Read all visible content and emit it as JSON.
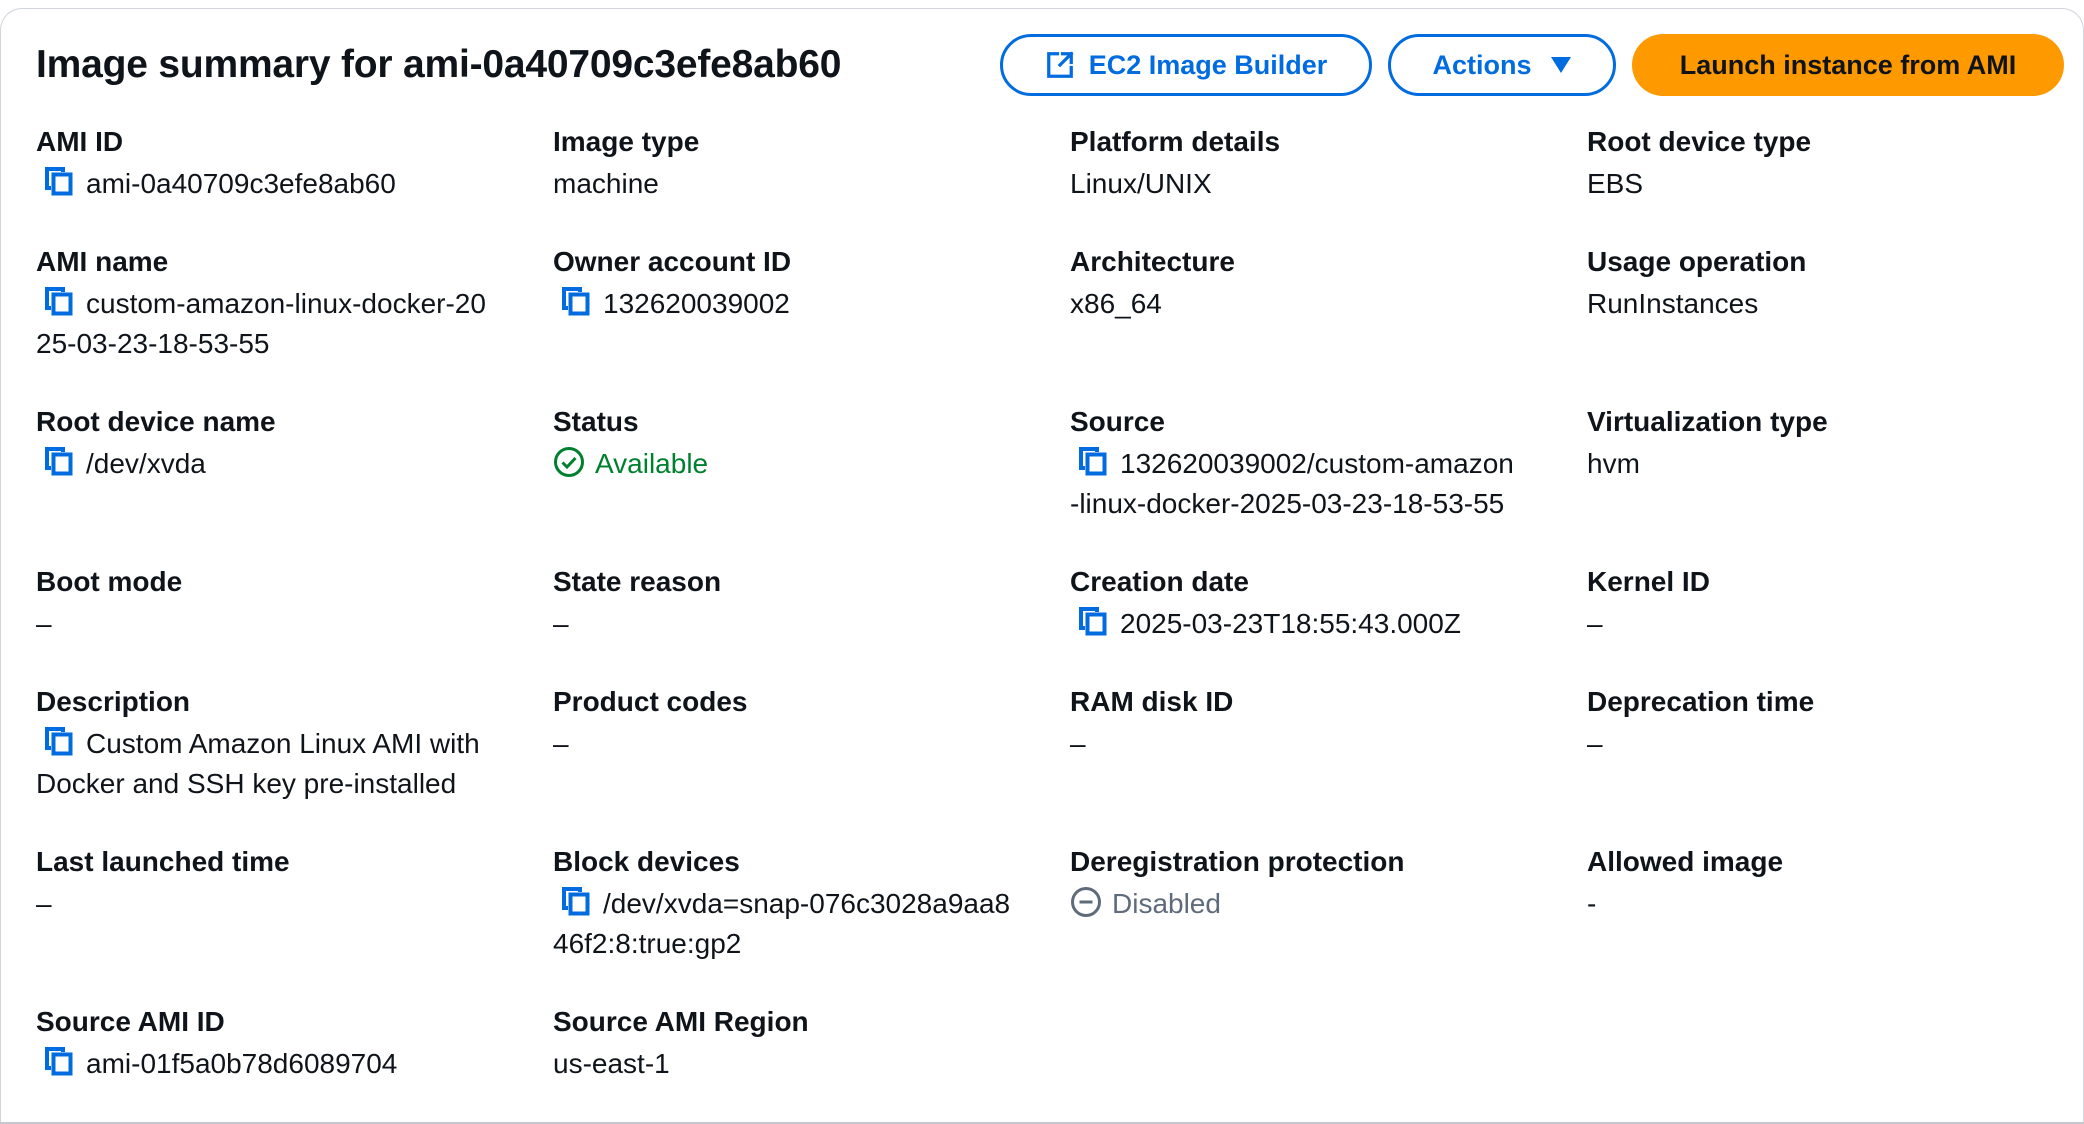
{
  "header": {
    "title": "Image summary for ami-0a40709c3efe8ab60",
    "ec2_builder_label": "EC2 Image Builder",
    "actions_label": "Actions",
    "launch_label": "Launch instance from AMI"
  },
  "fields": {
    "ami_id": {
      "label": "AMI ID",
      "value": "ami-0a40709c3efe8ab60"
    },
    "image_type": {
      "label": "Image type",
      "value": "machine"
    },
    "platform_details": {
      "label": "Platform details",
      "value": "Linux/UNIX"
    },
    "root_device_type": {
      "label": "Root device type",
      "value": "EBS"
    },
    "ami_name": {
      "label": "AMI name",
      "value_line1": "custom-amazon-linux-docker-20",
      "value_line2": "25-03-23-18-53-55"
    },
    "owner_account_id": {
      "label": "Owner account ID",
      "value": "132620039002"
    },
    "architecture": {
      "label": "Architecture",
      "value": "x86_64"
    },
    "usage_operation": {
      "label": "Usage operation",
      "value": "RunInstances"
    },
    "root_device_name": {
      "label": "Root device name",
      "value": "/dev/xvda"
    },
    "status": {
      "label": "Status",
      "value": "Available"
    },
    "source": {
      "label": "Source",
      "value_line1": "132620039002/custom-amazon",
      "value_line2": "-linux-docker-2025-03-23-18-53-55"
    },
    "virtualization_type": {
      "label": "Virtualization type",
      "value": "hvm"
    },
    "boot_mode": {
      "label": "Boot mode",
      "value": "–"
    },
    "state_reason": {
      "label": "State reason",
      "value": "–"
    },
    "creation_date": {
      "label": "Creation date",
      "value": "2025-03-23T18:55:43.000Z"
    },
    "kernel_id": {
      "label": "Kernel ID",
      "value": "–"
    },
    "description": {
      "label": "Description",
      "value_line1": "Custom Amazon Linux AMI with",
      "value_line2": "Docker and SSH key pre-installed"
    },
    "product_codes": {
      "label": "Product codes",
      "value": "–"
    },
    "ram_disk_id": {
      "label": "RAM disk ID",
      "value": "–"
    },
    "deprecation_time": {
      "label": "Deprecation time",
      "value": "–"
    },
    "last_launched_time": {
      "label": "Last launched time",
      "value": "–"
    },
    "block_devices": {
      "label": "Block devices",
      "value_line1": "/dev/xvda=snap-076c3028a9aa8",
      "value_line2": "46f2:8:true:gp2"
    },
    "deregistration_protection": {
      "label": "Deregistration protection",
      "value": "Disabled"
    },
    "allowed_image": {
      "label": "Allowed image",
      "value": "-"
    },
    "source_ami_id": {
      "label": "Source AMI ID",
      "value": "ami-01f5a0b78d6089704"
    },
    "source_ami_region": {
      "label": "Source AMI Region",
      "value": "us-east-1"
    }
  },
  "icons": {
    "copy": "copy-icon",
    "external": "external-link-icon",
    "caret": "caret-down-icon",
    "status_ok": "check-circle-icon",
    "status_disabled": "minus-circle-icon"
  },
  "colors": {
    "link_blue": "#006ce0",
    "primary_orange": "#ff9900",
    "success_green": "#00802f",
    "muted_gray": "#5f6b7a"
  }
}
